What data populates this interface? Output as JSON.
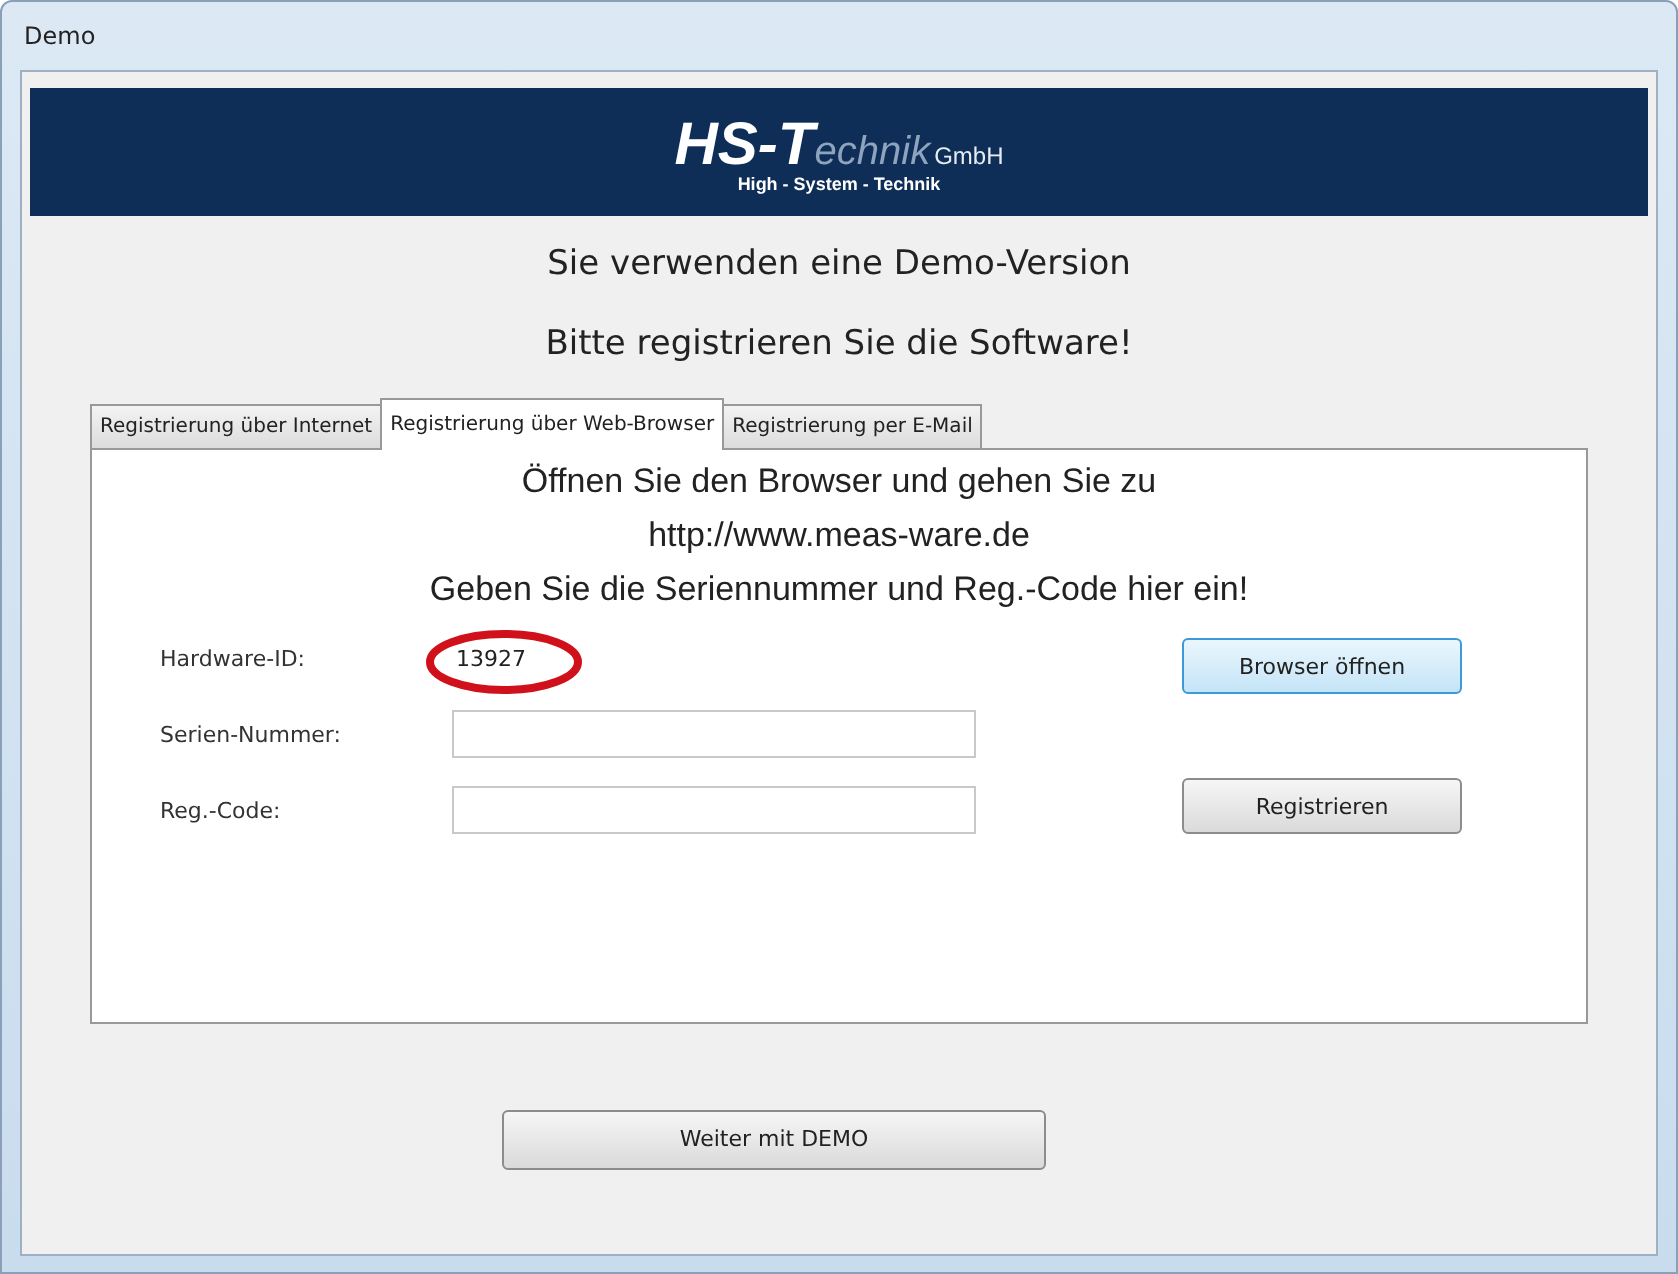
{
  "window": {
    "title": "Demo"
  },
  "logo": {
    "main": "HS-T",
    "rest": "echnik",
    "suffix": "GmbH",
    "tagline": "High - System - Technik"
  },
  "headings": [
    "Sie verwenden eine Demo-Version",
    "Bitte registrieren Sie die Software!"
  ],
  "tabs": [
    {
      "label": "Registrierung über Internet",
      "selected": false
    },
    {
      "label": "Registrierung über Web-Browser",
      "selected": true
    },
    {
      "label": "Registrierung per E-Mail",
      "selected": false
    }
  ],
  "instructions": [
    "Öffnen Sie den Browser und gehen Sie zu",
    "http://www.meas-ware.de",
    "Geben Sie die Seriennummer und Reg.-Code hier ein!"
  ],
  "hardware_id": {
    "label": "Hardware-ID:",
    "value": "13927",
    "highlighted": true
  },
  "fields": [
    {
      "label": "Serien-Nummer:"
    },
    {
      "label": "Reg.-Code:"
    }
  ],
  "buttons": {
    "browser": {
      "label": "Browser öffnen",
      "focused": true
    },
    "register": {
      "label": "Registrieren",
      "focused": false
    }
  },
  "demo_button": "Weiter mit DEMO"
}
